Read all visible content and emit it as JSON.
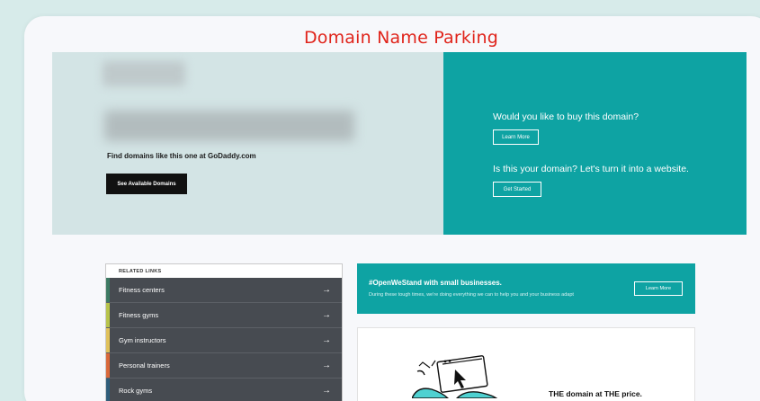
{
  "page_title": "Domain Name Parking",
  "hero": {
    "find_text": "Find domains like this one at GoDaddy.com",
    "available_button": "See Available Domains",
    "buy_question": "Would you like to buy this domain?",
    "learn_more": "Learn More",
    "website_question": "Is this your domain? Let's turn it into a website.",
    "get_started": "Get Started"
  },
  "related_links": {
    "title": "RELATED LINKS",
    "items": [
      {
        "label": "Fitness centers",
        "color": "#3d7a63"
      },
      {
        "label": "Fitness gyms",
        "color": "#b7c34a"
      },
      {
        "label": "Gym instructors",
        "color": "#e0c15a"
      },
      {
        "label": "Personal trainers",
        "color": "#d9683a"
      },
      {
        "label": "Rock gyms",
        "color": "#2f5d7a"
      }
    ]
  },
  "promo": {
    "title": "#OpenWeStand with small businesses.",
    "subtitle": "During these tough times, we're doing everything we can to help you and your business adapt",
    "button": "Learn More"
  },
  "dotcom": {
    "text": "THE domain at THE price."
  },
  "colors": {
    "accent": "#0ea3a3",
    "title_red": "#e0241b"
  }
}
